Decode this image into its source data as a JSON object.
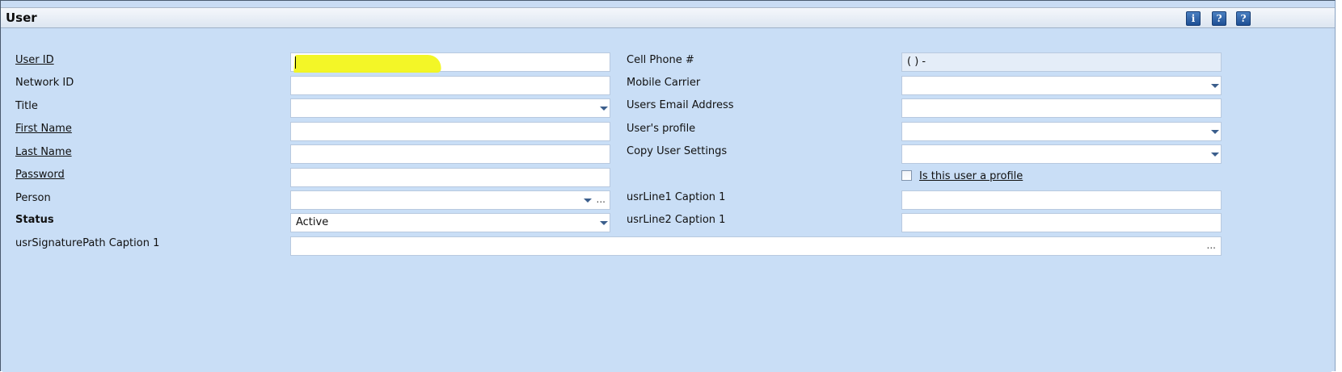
{
  "window": {
    "title": "User"
  },
  "toolbar": {
    "info_icon": "i",
    "help2_icon": "?",
    "help_icon": "?"
  },
  "left": {
    "user_id_label": "User ID",
    "network_id_label": "Network ID",
    "title_label": "Title",
    "first_name_label": "First Name",
    "last_name_label": "Last Name",
    "password_label": "Password",
    "person_label": "Person",
    "status_label": "Status",
    "status_value": "Active",
    "signature_label": "usrSignaturePath Caption 1",
    "person_ellipsis": "...",
    "signature_ellipsis": "..."
  },
  "right": {
    "cell_phone_label": "Cell Phone #",
    "cell_phone_value": "(    )      -",
    "mobile_carrier_label": "Mobile Carrier",
    "email_label": "Users Email Address",
    "profile_label": "User's profile",
    "copy_settings_label": "Copy User Settings",
    "is_profile_label": "Is this user a profile",
    "line1_label": "usrLine1 Caption 1",
    "line2_label": "usrLine2 Caption 1"
  }
}
